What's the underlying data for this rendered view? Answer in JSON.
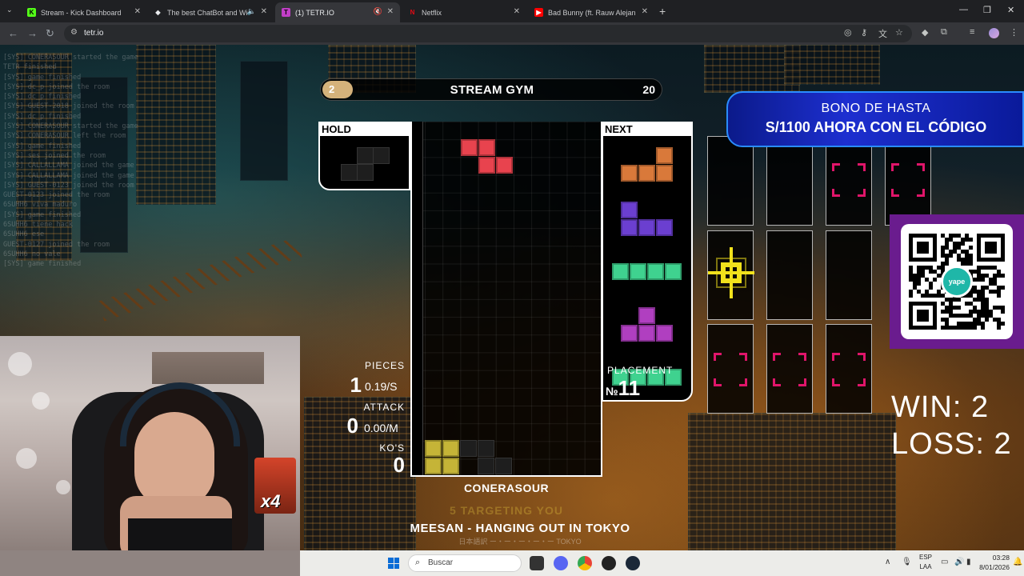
{
  "browser": {
    "tabs": [
      {
        "title": "Stream - Kick Dashboard",
        "favicon_color": "#53fc18",
        "favicon_glyph": "K"
      },
      {
        "title": "The best ChatBot and Widg",
        "favicon_color": "#e8eaed",
        "favicon_glyph": "◆"
      },
      {
        "title": "(1) TETR.IO",
        "favicon_color": "#c13ec7",
        "favicon_glyph": "T"
      },
      {
        "title": "Netflix",
        "favicon_color": "#e50914",
        "favicon_glyph": "N"
      },
      {
        "title": "Bad Bunny (ft. Rauw Alejandro)",
        "favicon_color": "#ff0000",
        "favicon_glyph": "▶"
      }
    ],
    "active_tab": 2,
    "url": "tetr.io"
  },
  "game": {
    "mode_badge": "2",
    "room_name": "STREAM GYM",
    "player_count": "20",
    "hold_label": "HOLD",
    "next_label": "NEXT",
    "stats": {
      "pieces_label": "PIECES",
      "pieces_value": "1",
      "pieces_rate": "0.19/S",
      "attack_label": "ATTACK",
      "attack_value": "0",
      "attack_rate": "0.00/M",
      "kos_label": "KO'S",
      "kos_value": "0"
    },
    "placement_label": "PLACEMENT",
    "placement_prefix": "№",
    "placement_value": "11",
    "player_name": "CONERASOUR",
    "targeting_text": "5 TARGETING YOU",
    "song_title": "MEESAN - HANGING OUT IN TOKYO",
    "song_subtitle": "日本語訳 ー・ー・ー・ー・ー TOKYO",
    "colors": {
      "z_piece": "#e8434e",
      "l_piece": "#d9793a",
      "j_piece": "#6b3fd0",
      "i_piece": "#3fd28f",
      "t_piece": "#b03fc0",
      "o_piece": "#c5b437",
      "target_color": "#e0156a",
      "crosshair_color": "#f1e11c"
    }
  },
  "overlays": {
    "bono_line1": "BONO DE HASTA",
    "bono_line2": "S/1100 AHORA CON EL CÓDIGO",
    "qr_logo_text": "yape",
    "win_text": "WIN: 2",
    "loss_text": "LOSS: 2",
    "emote_text": "x4"
  },
  "chatlog": [
    "[SYS] CONERASOUR started the game",
    "TETR finished",
    "[SYS] game finished",
    "[SYS] dc_p joined the room",
    "[SYS] dc_p finished",
    "[SYS] GUEST-2018 joined the room",
    "[SYS] dc_p finished",
    "[SYS] CONERASOUR started the game",
    "[SYS] CONERASOUR left the room",
    "[SYS] game finished",
    "[SYS] ses joined the room",
    "[SYS] CALLALLAMA joined the game",
    "[SYS] CALLALLAMA joined the game",
    "[SYS] GUEST-0123 joined the room",
    "GUEST-0123 joined the room",
    "6SUHH6 viva maduro",
    "[SYS] game finished",
    "6SUHH6 tiene hack",
    "6SUHH6 ese",
    "GUEST-0127 joined the room",
    "6SUHH6 no vale",
    "[SYS] game finished"
  ],
  "taskbar": {
    "search_placeholder": "Buscar",
    "language": "ESP",
    "language_sub": "LAA",
    "time": "03:28",
    "date": "8/01/2026"
  }
}
